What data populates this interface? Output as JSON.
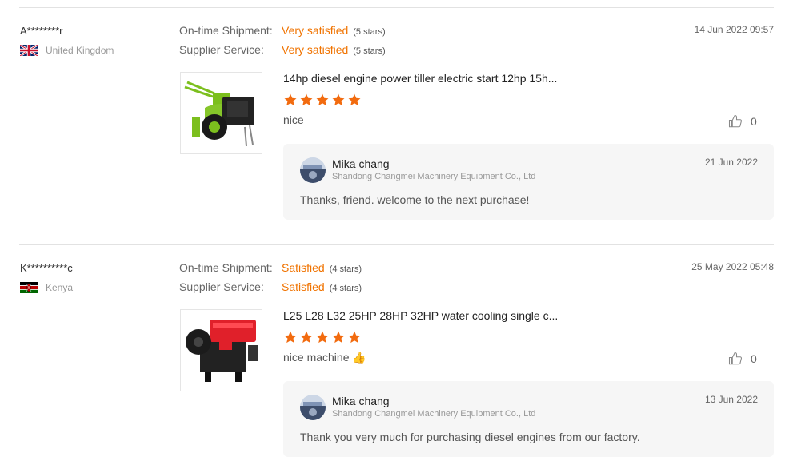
{
  "reviews": [
    {
      "buyer": "A********r",
      "country": "United Kingdom",
      "flag_icon": "uk-flag-icon",
      "shipment_label": "On-time Shipment:",
      "shipment_value": "Very satisfied",
      "shipment_stars": "(5 stars)",
      "service_label": "Supplier Service:",
      "service_value": "Very satisfied",
      "service_stars": "(5 stars)",
      "date": "14 Jun 2022 09:57",
      "product_title": "14hp diesel engine power tiller electric start 12hp 15h...",
      "rating": 5,
      "comment": "nice",
      "likes": "0",
      "reply": {
        "name": "Mika chang",
        "company": "Shandong Changmei Machinery Equipment Co., Ltd",
        "date": "21 Jun 2022",
        "text": "Thanks, friend. welcome to the next purchase!"
      }
    },
    {
      "buyer": "K**********c",
      "country": "Kenya",
      "flag_icon": "kenya-flag-icon",
      "shipment_label": "On-time Shipment:",
      "shipment_value": "Satisfied",
      "shipment_stars": "(4 stars)",
      "service_label": "Supplier Service:",
      "service_value": "Satisfied",
      "service_stars": "(4 stars)",
      "date": "25 May 2022 05:48",
      "product_title": "L25 L28 L32 25HP 28HP 32HP water cooling single c...",
      "rating": 5,
      "comment": "nice machine",
      "comment_emoji": "👍",
      "likes": "0",
      "reply": {
        "name": "Mika chang",
        "company": "Shandong Changmei Machinery Equipment Co., Ltd",
        "date": "13 Jun 2022",
        "text": "Thank you very much for purchasing diesel engines from our factory."
      }
    }
  ],
  "colors": {
    "accent": "#f07300",
    "star": "#f26b0f",
    "reply_bg": "#f6f6f6"
  }
}
